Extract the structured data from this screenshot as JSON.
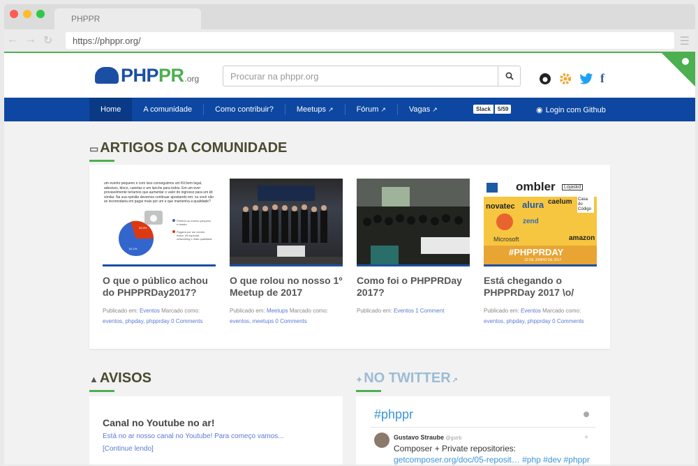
{
  "browser": {
    "tab_title": "PHPPR",
    "url": "https://phppr.org/"
  },
  "header": {
    "logo_text_a": "PHP",
    "logo_text_b": "PR",
    "logo_org": ".org",
    "search_placeholder": "Procurar na phppr.org"
  },
  "nav": {
    "items": [
      "Home",
      "A comunidade",
      "Como contribuir?",
      "Meetups",
      "Fórum",
      "Vagas"
    ],
    "slack_label": "Slack",
    "slack_count": "5/59",
    "login": "Login com Github"
  },
  "artigos": {
    "title": "ARTIGOS DA COMUNIDADE",
    "items": [
      {
        "title": "O que o público achou do PHPPRDay2017?",
        "meta_prefix": "Publicado em:",
        "category": "Eventos",
        "tagged": "Marcado como:",
        "tags": "eventos, phpday, phpprday",
        "comments": "0 Comments"
      },
      {
        "title": "O que rolou no nosso 1º Meetup de 2017",
        "meta_prefix": "Publicado em:",
        "category": "Meetups",
        "tagged": "Marcado como:",
        "tags": "eventos, meetups",
        "comments": "0 Comments"
      },
      {
        "title": "Como foi o PHPPRDay 2017?",
        "meta_prefix": "Publicado em:",
        "category": "Eventos",
        "tagged": "",
        "tags": "",
        "comments": "1 Comment"
      },
      {
        "title": "Está chegando o PHPPRDay 2017 \\o/",
        "meta_prefix": "Publicado em:",
        "category": "Eventos",
        "tagged": "Marcado como:",
        "tags": "eventos, phpday, phpprday",
        "comments": "0 Comments"
      }
    ],
    "thumb1_text": "um evento pequeno e com isso conseguimos um Kit bem legal, adesivos, bloco, canetas e um lanche para todos. Em um ever provavelmente teríamos que aumentar o valor do ingresso para um kit similar. Na sua opinião devemos continuar apostando em: ou você não se incomodaria em pagar mais por um e que mantenha a qualidade?",
    "thumb1_pct_a": "26.3%",
    "thumb1_pct_b": "61.1%",
    "thumb1_legend_a": "Preferiu ao evento pequeno e barato",
    "thumb1_legend_b": "Pagaria por um evento maior, kit especial, networking e mais qualidade",
    "thumb4_banner": "#PHPPRDAY",
    "thumb4_date": "10 DE JUNHO DE 2017",
    "thumb4_sponsors": [
      "ombler",
      "novatec",
      "alura",
      "caelum",
      "zend",
      "Microsoft",
      "amazon",
      "Lojaskd",
      "Casa do Código"
    ]
  },
  "avisos": {
    "title": "AVISOS",
    "item_title": "Canal no Youtube no ar!",
    "item_text": "Está no ar nosso canal no Youtube! Para começo vamos...",
    "item_link": "[Continue lendo]"
  },
  "twitter": {
    "title": "NO TWITTER",
    "handle": "#phppr",
    "tweet_author": "Gustavo Straube",
    "tweet_user": "@gstrb",
    "tweet_text": "Composer + Private repositories:",
    "tweet_link": "getcomposer.org/doc/05-reposit… #php #dev #phppr"
  },
  "colors": {
    "nav_blue": "#0d47a1",
    "accent_green": "#4caf50",
    "link_blue": "#5b7bd5"
  }
}
